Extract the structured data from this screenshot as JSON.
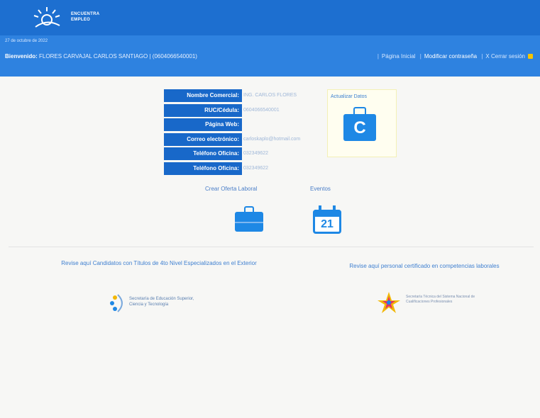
{
  "header": {
    "brand_line1": "ENCUENTRA",
    "brand_line2": "EMPLEO"
  },
  "subbar": {
    "date": "27 de octubre de 2022",
    "welcome_label": "Bienvenido:",
    "welcome_name": "FLORES CARVAJAL CARLOS SANTIAGO",
    "welcome_id": "(0604066540001)",
    "nav": {
      "home": "Página Inicial",
      "change_password": "Modificar contraseña",
      "logout": "Cerrar sesión"
    }
  },
  "company_info": {
    "rows": [
      {
        "label": "Nombre Comercial:",
        "value": "ING. CARLOS FLORES"
      },
      {
        "label": "RUC/Cédula:",
        "value": "0604066540001"
      },
      {
        "label": "Página Web:",
        "value": ""
      },
      {
        "label": "Correo electrónico:",
        "value": "carloskaplo@hotmail.com"
      },
      {
        "label": "Teléfono Oficina:",
        "value": "032349622"
      },
      {
        "label": "Teléfono Oficina:",
        "value": "032349622"
      }
    ]
  },
  "update_card": {
    "title": "Actualizar Datos",
    "icon_letter": "C"
  },
  "actions": {
    "create_offer": "Crear Oferta Laboral",
    "events": "Eventos",
    "calendar_day": "21"
  },
  "footer": {
    "left_link": "Revise aquí Candidatos con Títulos de 4to Nivel Especializados en el Exterior",
    "right_link": "Revise aquí personal certificado en competencias laborales",
    "left_logo_text": "Secretaría de Educación Superior, Ciencia y Tecnología",
    "right_logo_text": "Secretaría Técnica del Sistema Nacional de Cualificaciones Profesionales"
  },
  "colors": {
    "topbar": "#1d6fd0",
    "subbar": "#2e82e0",
    "label_bg": "#1868c9",
    "icon_blue": "#1e88e5"
  }
}
